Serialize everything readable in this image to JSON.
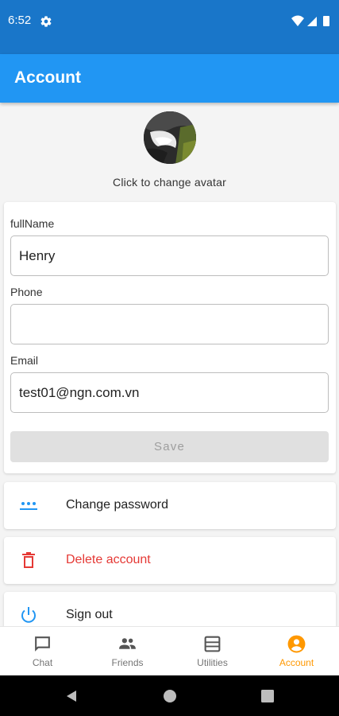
{
  "status_bar": {
    "time": "6:52"
  },
  "app_bar": {
    "title": "Account"
  },
  "profile": {
    "avatar_caption": "Click to change avatar"
  },
  "form": {
    "fullname_label": "fullName",
    "fullname_value": "Henry",
    "phone_label": "Phone",
    "phone_value": "",
    "email_label": "Email",
    "email_value": "test01@ngn.com.vn",
    "save_label": "Save"
  },
  "actions": {
    "change_password": "Change password",
    "delete_account": "Delete account",
    "sign_out": "Sign out"
  },
  "bottom_nav": {
    "items": [
      {
        "label": "Chat",
        "icon": "chat-icon"
      },
      {
        "label": "Friends",
        "icon": "people-icon"
      },
      {
        "label": "Utilities",
        "icon": "list-icon"
      },
      {
        "label": "Account",
        "icon": "account-circle-icon"
      }
    ],
    "active": "Account"
  },
  "colors": {
    "status_bar": "#1976c9",
    "app_bar": "#2196f3",
    "active_nav": "#ff9800",
    "danger": "#e53935",
    "primary_icon": "#2196f3"
  }
}
